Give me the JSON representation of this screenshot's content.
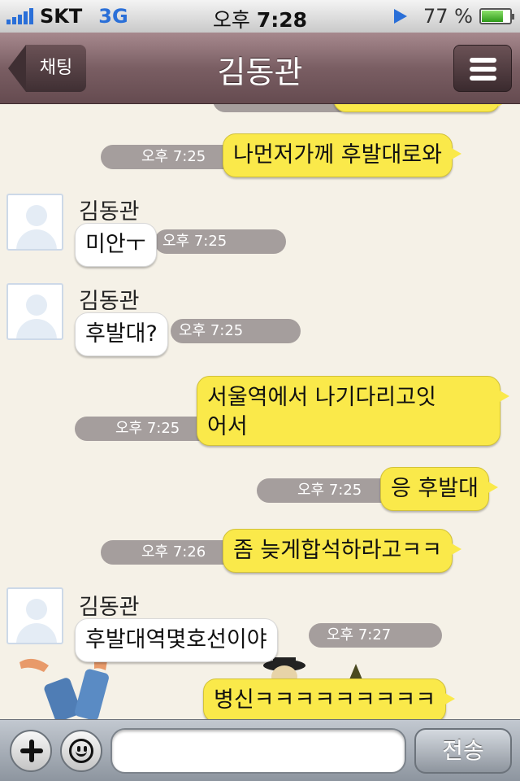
{
  "status_bar": {
    "carrier": "SKT",
    "network": "3G",
    "time_prefix": "오후",
    "time": "7:28",
    "battery": "77 %",
    "battery_level": 0.77
  },
  "nav": {
    "back_label": "채팅",
    "title": "김동관"
  },
  "messages": [
    {
      "side": "me",
      "text": "나먼저가께 후발대로와",
      "time": "오후 7:25"
    },
    {
      "side": "them",
      "sender": "김동관",
      "text": "미안ㅜ",
      "time": "오후 7:25"
    },
    {
      "side": "them",
      "sender": "김동관",
      "text": "후발대?",
      "time": "오후 7:25"
    },
    {
      "side": "me",
      "text": "서울역에서 나기다리고잇\n어서",
      "time": "오후 7:25"
    },
    {
      "side": "me",
      "text": "응 후발대",
      "time": "오후 7:25"
    },
    {
      "side": "me",
      "text": "좀 늦게합석하라고ㅋㅋ",
      "time": "오후 7:26"
    },
    {
      "side": "them",
      "sender": "김동관",
      "text": "후발대역몇호선이야",
      "time": "오후 7:27"
    },
    {
      "side": "me",
      "text": "병신ㅋㅋㅋㅋㅋㅋㅋㅋㅋ",
      "time": ""
    }
  ],
  "input": {
    "value": "",
    "send_label": "전송"
  }
}
